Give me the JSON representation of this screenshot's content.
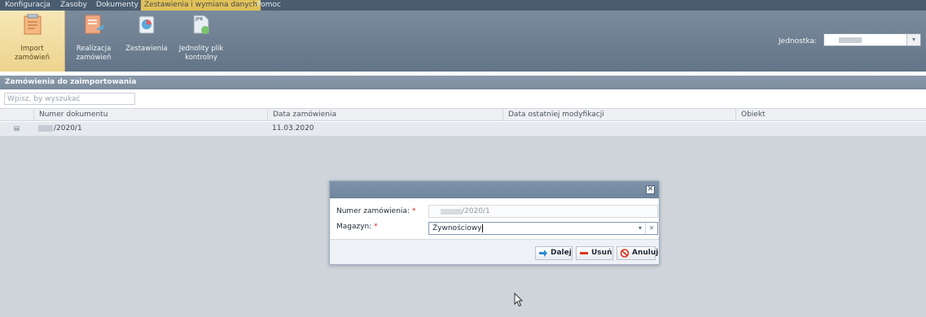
{
  "menu": {
    "items": [
      {
        "label": "Konfiguracja",
        "active": false
      },
      {
        "label": "Zasoby",
        "active": false
      },
      {
        "label": "Dokumenty",
        "active": false
      },
      {
        "label": "Zestawienia i wymiana danych",
        "active": true
      },
      {
        "label": "Pomoc",
        "active": false
      }
    ]
  },
  "ribbon": {
    "buttons": [
      {
        "label": "Import\nzamówień",
        "icon": "import-orders-icon",
        "active": true
      },
      {
        "label": "Realizacja\nzamówień",
        "icon": "fulfill-orders-icon",
        "active": false
      },
      {
        "label": "Zestawienia",
        "icon": "reports-icon",
        "active": false
      },
      {
        "label": "Jednolity plik\nkontrolny",
        "icon": "jpk-file-icon",
        "active": false
      }
    ],
    "jpk_badge": "JPK",
    "unit_label": "Jednostka:"
  },
  "panel": {
    "title": "Zamówienia do zaimportowania",
    "search_placeholder": "Wpisz, by wyszukać"
  },
  "grid": {
    "columns": [
      "Numer dokumentu",
      "Data zamówienia",
      "Data ostatniej modyfikacji",
      "Obiekt"
    ],
    "rows": [
      {
        "doc_number": "/2020/1",
        "order_date": "11.03.2020",
        "modified": "",
        "object": ""
      }
    ]
  },
  "dialog": {
    "order_label": "Numer zamówienia:",
    "order_value": "/2020/1",
    "warehouse_label": "Magazyn:",
    "warehouse_value": "Żywnościowy",
    "required_mark": "*",
    "buttons": {
      "next": "Dalej",
      "remove": "Usuń",
      "cancel": "Anuluj"
    }
  },
  "colors": {
    "menu_bg": "#4a5d70",
    "menu_active": "#e0c15a",
    "ribbon_bg": "#6f8092",
    "ribbon_active": "#f1dc9f",
    "required": "#d9261c"
  }
}
